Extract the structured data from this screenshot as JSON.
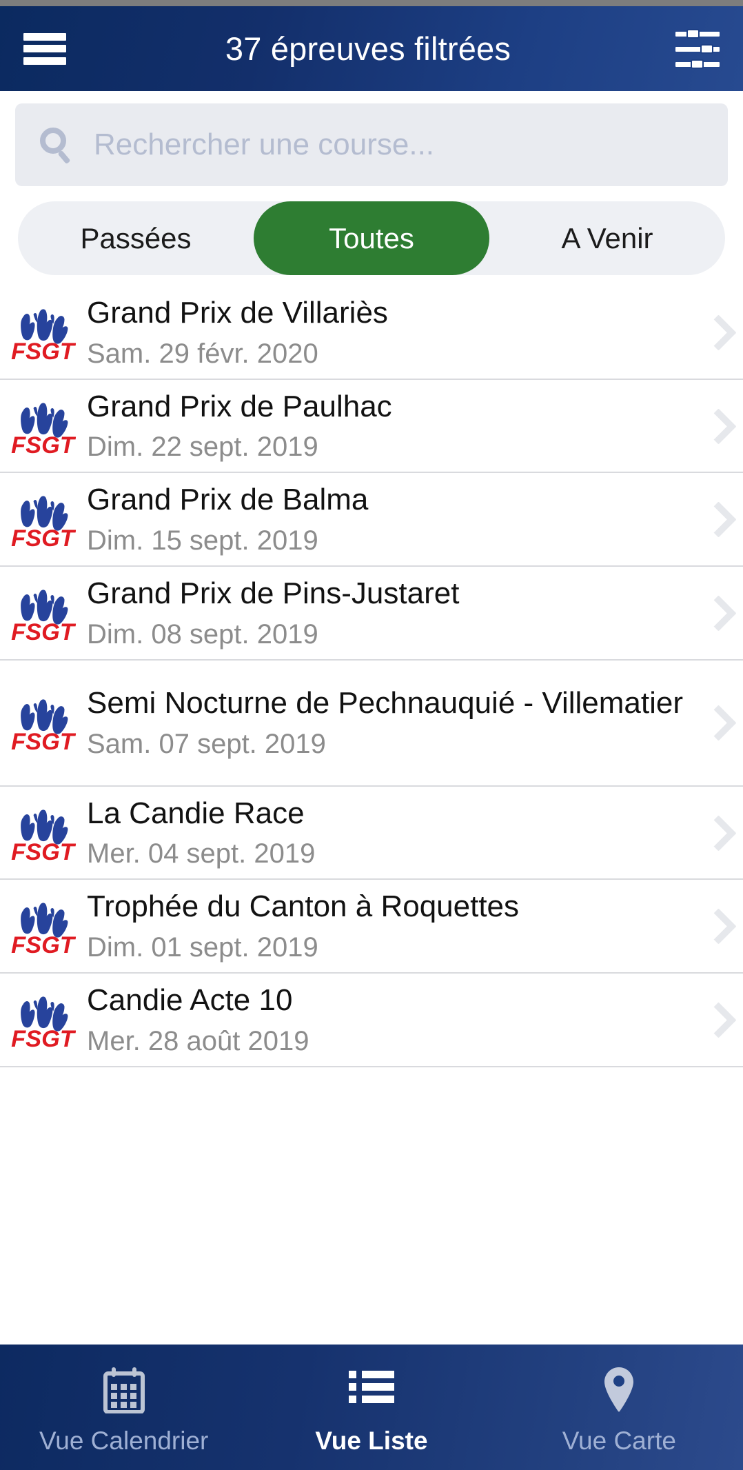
{
  "header": {
    "title": "37 épreuves filtrées",
    "menu_icon": "hamburger-menu-icon",
    "filter_icon": "filter-sliders-icon"
  },
  "search": {
    "placeholder": "Rechercher une course...",
    "value": "",
    "icon": "search-icon"
  },
  "tabs": [
    {
      "label": "Passées",
      "active": false
    },
    {
      "label": "Toutes",
      "active": true
    },
    {
      "label": "A Venir",
      "active": false
    }
  ],
  "colors": {
    "header_blue": "#132f6b",
    "accent_green": "#2e7d32",
    "logo_blue": "#27439c",
    "logo_red": "#e01b22",
    "chevron_gray": "#e6e8ec",
    "date_gray": "#8c8c8c"
  },
  "races": [
    {
      "title": "Grand Prix de Villariès",
      "date": "Sam. 29 févr. 2020",
      "logo": "fsgt-logo",
      "chevron": "chevron-right-icon"
    },
    {
      "title": "Grand Prix de Paulhac",
      "date": "Dim. 22 sept. 2019",
      "logo": "fsgt-logo",
      "chevron": "chevron-right-icon"
    },
    {
      "title": "Grand Prix de Balma",
      "date": "Dim. 15 sept. 2019",
      "logo": "fsgt-logo",
      "chevron": "chevron-right-icon"
    },
    {
      "title": "Grand Prix de Pins-Justaret",
      "date": "Dim. 08 sept. 2019",
      "logo": "fsgt-logo",
      "chevron": "chevron-right-icon"
    },
    {
      "title": "Semi Nocturne de Pechnauquié - Villematier",
      "date": "Sam. 07 sept. 2019",
      "logo": "fsgt-logo",
      "chevron": "chevron-right-icon"
    },
    {
      "title": "La Candie Race",
      "date": "Mer. 04 sept. 2019",
      "logo": "fsgt-logo",
      "chevron": "chevron-right-icon"
    },
    {
      "title": "Trophée du Canton à Roquettes",
      "date": "Dim. 01 sept. 2019",
      "logo": "fsgt-logo",
      "chevron": "chevron-right-icon"
    },
    {
      "title": "Candie Acte 10",
      "date": "Mer. 28 août 2019",
      "logo": "fsgt-logo",
      "chevron": "chevron-right-icon"
    }
  ],
  "bottom_nav": [
    {
      "label": "Vue Calendrier",
      "icon": "calendar-icon",
      "active": false
    },
    {
      "label": "Vue Liste",
      "icon": "list-icon",
      "active": true
    },
    {
      "label": "Vue Carte",
      "icon": "map-pin-icon",
      "active": false
    }
  ]
}
